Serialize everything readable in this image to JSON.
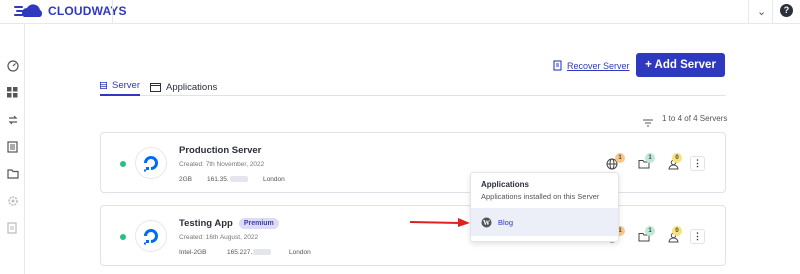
{
  "app": {
    "logo_text": "CLOUDWAYS"
  },
  "header": {
    "recover_label": "Recover Server",
    "add_server_label": "+ Add Server"
  },
  "tabs": [
    {
      "label": "Server",
      "active": true
    },
    {
      "label": "Applications",
      "active": false
    }
  ],
  "list": {
    "count_text": "1 to 4 of 4 Servers"
  },
  "servers": [
    {
      "name": "Production Server",
      "badge": "",
      "created": "Created: 7th November, 2022",
      "size": "2GB",
      "ip": "161.35.",
      "location": "London",
      "status_color": "#26c281",
      "counts": {
        "apps": "1",
        "folders": "1",
        "users": "0"
      }
    },
    {
      "name": "Testing App",
      "badge": "Premium",
      "created": "Created: 16th August, 2022",
      "size": "Intel-2GB",
      "ip": "165.227.",
      "location": "London",
      "status_color": "#26c281",
      "counts": {
        "apps": "1",
        "folders": "1",
        "users": "0"
      }
    }
  ],
  "popup": {
    "title": "Applications",
    "subtitle": "Applications installed on this Server",
    "items": [
      {
        "label": "Blog",
        "icon": "wordpress-icon"
      }
    ]
  },
  "colors": {
    "brand": "#2f39bf",
    "online": "#26c281",
    "apps_badge": "#f6c98a",
    "folders_badge": "#bfe8d6",
    "users_badge": "#f5e27a"
  }
}
